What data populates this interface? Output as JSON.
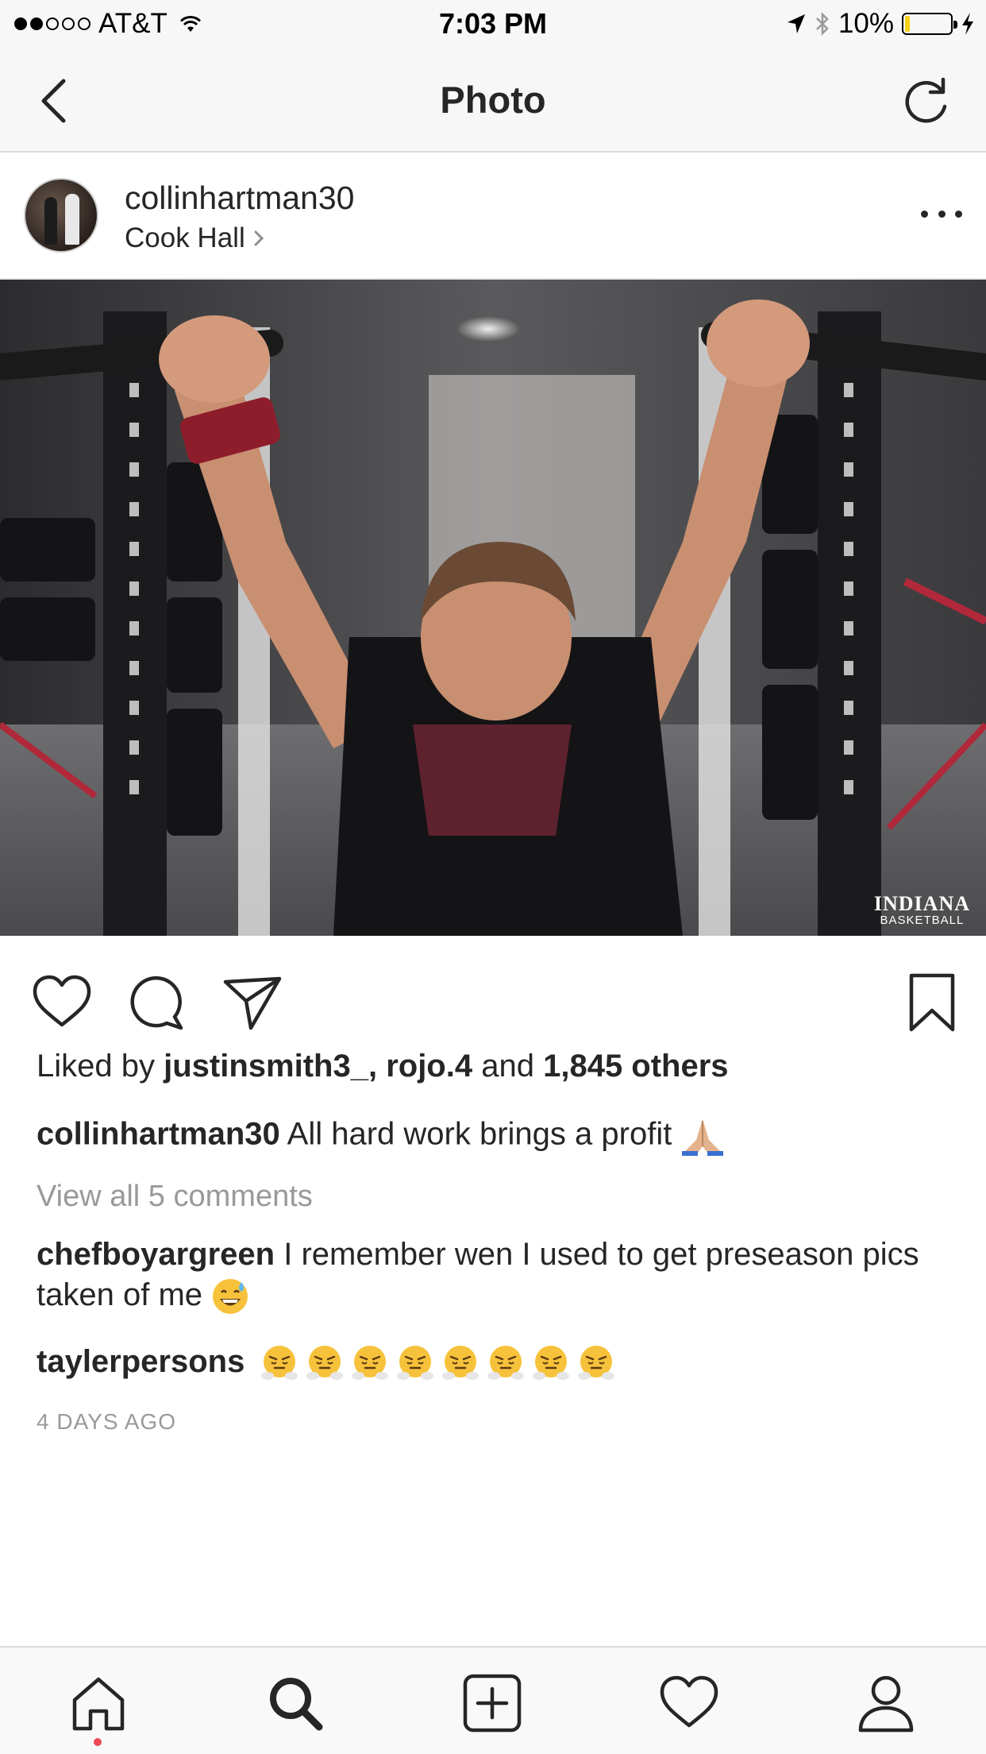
{
  "status_bar": {
    "carrier": "AT&T",
    "time": "7:03 PM",
    "battery_text": "10%",
    "battery_level": 0.1,
    "signal_strength": 2,
    "icons": [
      "signal-dots-icon",
      "wifi-icon",
      "location-arrow-icon",
      "bluetooth-icon",
      "battery-icon",
      "charging-bolt-icon"
    ]
  },
  "header": {
    "title": "Photo",
    "back_icon": "chevron-left-icon",
    "refresh_icon": "refresh-icon"
  },
  "post": {
    "username": "collinhartman30",
    "location": "Cook Hall",
    "photo": {
      "watermark_line1": "INDIANA",
      "watermark_line2": "BASKETBALL"
    },
    "likes": {
      "prefix": "Liked by",
      "user1": "justinsmith3_,",
      "user2": "rojo.4",
      "and": "and",
      "others": "1,845 others"
    },
    "caption": {
      "username": "collinhartman30",
      "text": "All hard work brings a profit",
      "emoji": "folded-hands-emoji"
    },
    "view_comments": "View all 5 comments",
    "comments": [
      {
        "username": "chefboyargreen",
        "text": "I remember wen I used to get preseason pics taken of me",
        "emoji": "sweat-smile-emoji"
      },
      {
        "username": "taylerpersons",
        "text": "",
        "emoji": "steam-face-emoji",
        "emoji_count": 8
      }
    ],
    "timestamp": "4 DAYS AGO"
  },
  "actions": [
    "heart-icon",
    "comment-icon",
    "share-icon",
    "bookmark-icon"
  ],
  "tab_bar": [
    "home-icon",
    "search-icon",
    "add-post-icon",
    "activity-heart-icon",
    "profile-icon"
  ],
  "colors": {
    "text": "#262626",
    "muted": "#999999",
    "bar_bg": "#f7f7f7",
    "notification": "#ed4956",
    "battery": "#f7d117"
  }
}
